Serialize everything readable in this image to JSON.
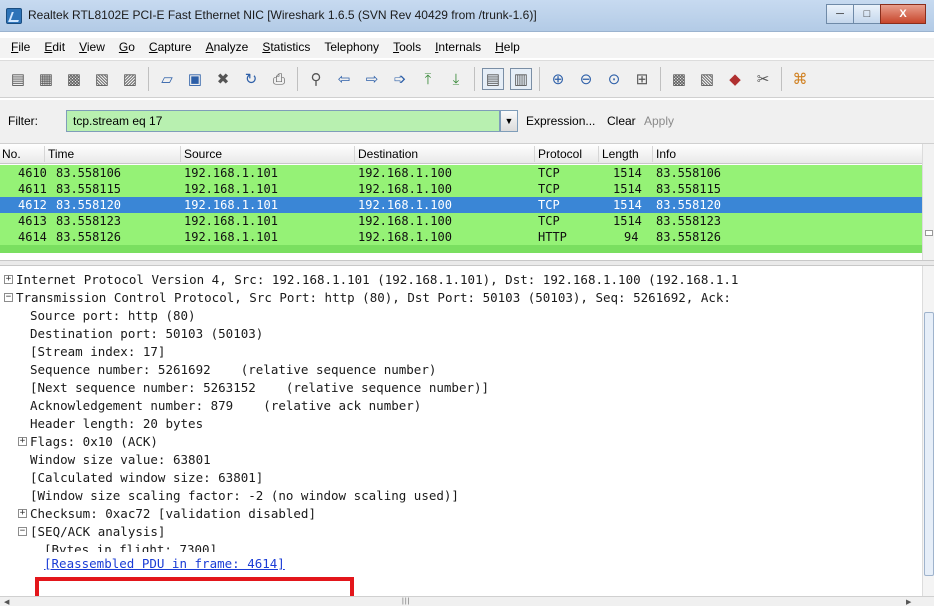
{
  "window": {
    "title": "Realtek RTL8102E PCI-E Fast Ethernet NIC  [Wireshark 1.6.5  (SVN Rev 40429 from /trunk-1.6)]",
    "minimize": "─",
    "maximize": "□",
    "close": "X"
  },
  "menu": [
    {
      "first": "F",
      "rest": "ile"
    },
    {
      "first": "E",
      "rest": "dit"
    },
    {
      "first": "V",
      "rest": "iew"
    },
    {
      "first": "G",
      "rest": "o"
    },
    {
      "first": "C",
      "rest": "apture"
    },
    {
      "first": "A",
      "rest": "nalyze"
    },
    {
      "first": "S",
      "rest": "tatistics"
    },
    {
      "first": "",
      "rest": "Telephony"
    },
    {
      "first": "T",
      "rest": "ools"
    },
    {
      "first": "I",
      "rest": "nternals"
    },
    {
      "first": "H",
      "rest": "elp"
    }
  ],
  "toolbar_icons": [
    "interface-list-icon",
    "capture-options-icon",
    "start-capture-icon",
    "stop-capture-icon",
    "restart-capture-icon",
    "open-file-icon",
    "save-file-icon",
    "close-file-icon",
    "reload-icon",
    "print-icon",
    "find-packet-icon",
    "go-back-icon",
    "go-forward-icon",
    "go-to-packet-icon",
    "go-first-icon",
    "go-last-icon",
    "colorize-icon",
    "auto-scroll-icon",
    "zoom-in-icon",
    "zoom-out-icon",
    "normal-size-icon",
    "resize-columns-icon",
    "capture-filters-icon",
    "display-filters-icon",
    "coloring-rules-icon",
    "preferences-icon",
    "help-icon"
  ],
  "filter": {
    "label": "Filter:",
    "value": "tcp.stream eq 17",
    "expression": "Expression...",
    "clear": "Clear",
    "apply": "Apply"
  },
  "packet_list": {
    "columns": [
      "No.",
      "Time",
      "Source",
      "Destination",
      "Protocol",
      "Length",
      "Info"
    ],
    "rows": [
      {
        "no": "4610",
        "time": "83.558106",
        "source": "192.168.1.101",
        "destination": "192.168.1.100",
        "protocol": "TCP",
        "length": "1514",
        "info": "83.558106",
        "selected": false
      },
      {
        "no": "4611",
        "time": "83.558115",
        "source": "192.168.1.101",
        "destination": "192.168.1.100",
        "protocol": "TCP",
        "length": "1514",
        "info": "83.558115",
        "selected": false
      },
      {
        "no": "4612",
        "time": "83.558120",
        "source": "192.168.1.101",
        "destination": "192.168.1.100",
        "protocol": "TCP",
        "length": "1514",
        "info": "83.558120",
        "selected": true
      },
      {
        "no": "4613",
        "time": "83.558123",
        "source": "192.168.1.101",
        "destination": "192.168.1.100",
        "protocol": "TCP",
        "length": "1514",
        "info": "83.558123",
        "selected": false
      },
      {
        "no": "4614",
        "time": "83.558126",
        "source": "192.168.1.101",
        "destination": "192.168.1.100",
        "protocol": "HTTP",
        "length": "94",
        "info": "83.558126",
        "selected": false
      }
    ]
  },
  "details": {
    "ip_line": "Internet Protocol Version 4, Src: 192.168.1.101 (192.168.1.101), Dst: 192.168.1.100 (192.168.1.1",
    "tcp_line": "Transmission Control Protocol, Src Port: http (80), Dst Port: 50103 (50103), Seq: 5261692, Ack:",
    "fields": [
      "Source port: http (80)",
      "Destination port: 50103 (50103)",
      "[Stream index: 17]",
      "Sequence number: 5261692    (relative sequence number)",
      "[Next sequence number: 5263152    (relative sequence number)]",
      "Acknowledgement number: 879    (relative ack number)",
      "Header length: 20 bytes"
    ],
    "flags": "Flags: 0x10 (ACK)",
    "window_fields": [
      "Window size value: 63801",
      "[Calculated window size: 63801]",
      "[Window size scaling factor: -2 (no window scaling used)]"
    ],
    "checksum": "Checksum: 0xac72 [validation disabled]",
    "seqack": "[SEQ/ACK analysis]",
    "bytes_in_flight": "[Bytes in flight: 7300]",
    "reassembled_link": "[Reassembled PDU in frame: 4614]"
  }
}
